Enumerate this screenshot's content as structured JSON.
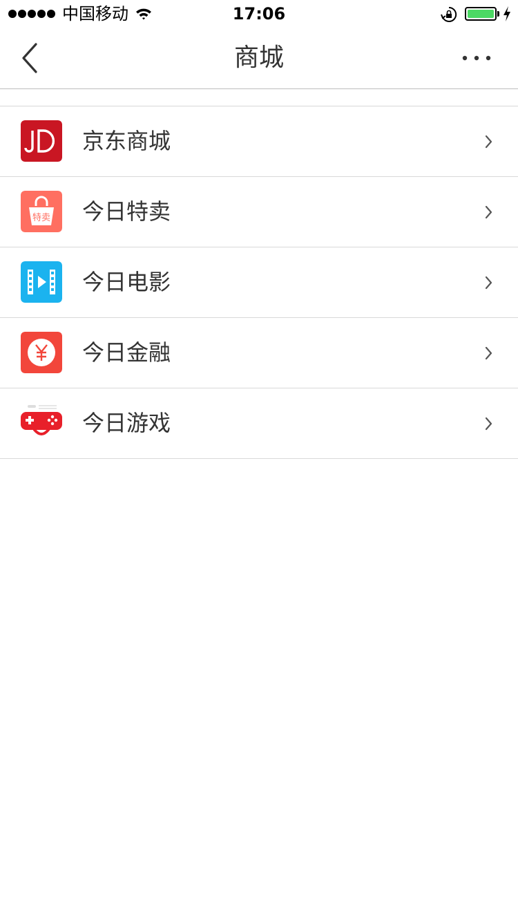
{
  "status_bar": {
    "carrier": "中国移动",
    "time": "17:06",
    "signal_bars": 5,
    "battery_level": 1.0,
    "battery_color": "#4cd964",
    "icons": [
      "signal-dots-icon",
      "wifi-icon",
      "rotation-lock-icon",
      "battery-icon",
      "charging-bolt-icon"
    ]
  },
  "nav": {
    "title": "商城",
    "back_icon": "back-chevron-icon",
    "more_icon": "more-dots-icon"
  },
  "list": {
    "items": [
      {
        "label": "京东商城",
        "icon": "jd-logo-icon",
        "icon_color": "#c91623"
      },
      {
        "label": "今日特卖",
        "icon": "shopping-bag-icon",
        "icon_color": "#ff6f61",
        "icon_badge_text": "特卖"
      },
      {
        "label": "今日电影",
        "icon": "film-icon",
        "icon_color": "#1bb3ef"
      },
      {
        "label": "今日金融",
        "icon": "yuan-coin-icon",
        "icon_color": "#f2463b"
      },
      {
        "label": "今日游戏",
        "icon": "gamepad-icon",
        "icon_color": "#e8202a"
      }
    ],
    "chevron_icon": "chevron-right-icon"
  }
}
